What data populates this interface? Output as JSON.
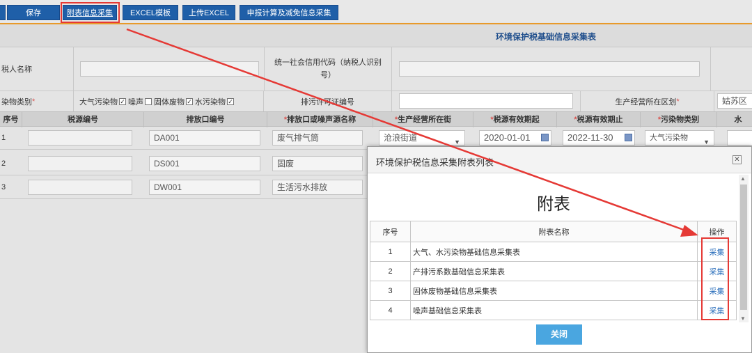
{
  "toolbar": {
    "buttons": [
      {
        "label": "保存"
      },
      {
        "label": "附表信息采集"
      },
      {
        "label": "EXCEL模板"
      },
      {
        "label": "上传EXCEL"
      },
      {
        "label": "申报计算及减免信息采集"
      }
    ]
  },
  "form": {
    "title": "环境保护税基础信息采集表",
    "taxpayer_name_label": "税人名称",
    "credit_code_label": "统一社会信用代码（纳税人识别号）",
    "pollutant_type_label": "染物类别",
    "pollutant_options": [
      {
        "label": "大气污染物",
        "checked": true
      },
      {
        "label": "噪声",
        "checked": false
      },
      {
        "label": "固体废物",
        "checked": true
      },
      {
        "label": "水污染物",
        "checked": true
      }
    ],
    "permit_label": "排污许可证编号",
    "region_label": "生产经营所在区划",
    "region_value": "姑苏区"
  },
  "table": {
    "headers": [
      "序号",
      "税源编号",
      "排放口编号",
      "排放口或噪声源名称",
      "生产经营所在街",
      "税源有效期起",
      "税源有效期止",
      "污染物类别",
      "水"
    ],
    "rows": [
      {
        "seq": "1",
        "outlet": "DA001",
        "name": "废气排气筒",
        "street": "沧浪街道",
        "start": "2020-01-01",
        "end": "2022-11-30",
        "category": "大气污染物"
      },
      {
        "seq": "2",
        "outlet": "DS001",
        "name": "固废"
      },
      {
        "seq": "3",
        "outlet": "DW001",
        "name": "生活污水排放"
      }
    ]
  },
  "dialog": {
    "title": "环境保护税信息采集附表列表",
    "heading": "附表",
    "col_seq": "序号",
    "col_name": "附表名称",
    "col_op": "操作",
    "rows": [
      {
        "seq": "1",
        "name": "大气、水污染物基础信息采集表",
        "action": "采集"
      },
      {
        "seq": "2",
        "name": "产排污系数基础信息采集表",
        "action": "采集"
      },
      {
        "seq": "3",
        "name": "固体废物基础信息采集表",
        "action": "采集"
      },
      {
        "seq": "4",
        "name": "噪声基础信息采集表",
        "action": "采集"
      }
    ],
    "close_label": "关闭"
  },
  "annotation_color": "#e53935",
  "accent_color": "#1f5fa8"
}
